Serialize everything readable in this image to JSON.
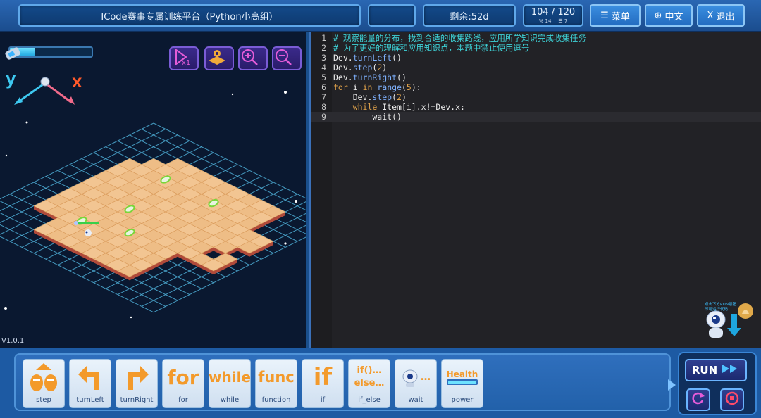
{
  "header": {
    "title": "ICode赛事专属训练平台（Python小高组）",
    "time_remaining": "剩余:52d",
    "score_main": "104 / 120",
    "score_sub_a": "14",
    "score_sub_b": "7",
    "menu_label": "菜单",
    "lang_label": "中文",
    "exit_label": "退出"
  },
  "game": {
    "version": "V1.0.1",
    "axis_y": "y",
    "axis_x": "x",
    "energy_fraction": 0.3,
    "tools": [
      "speed-x1",
      "map-view",
      "zoom-in",
      "zoom-out"
    ]
  },
  "editor": {
    "lines": [
      {
        "num": "1",
        "text": "# 观察能量的分布，找到合适的收集路线，应用所学知识完成收集任务"
      },
      {
        "num": "2",
        "text": "# 为了更好的理解和应用知识点，本题中禁止使用逗号"
      },
      {
        "num": "3",
        "text": "Dev.turnLeft()"
      },
      {
        "num": "4",
        "text": "Dev.step(2)"
      },
      {
        "num": "5",
        "text": "Dev.turnRight()"
      },
      {
        "num": "6",
        "text": "for i in range(5):"
      },
      {
        "num": "7",
        "text": "    Dev.step(2)"
      },
      {
        "num": "8",
        "text": "    while Item[i].x!=Dev.x:"
      },
      {
        "num": "9",
        "text": "        wait()"
      }
    ],
    "hint_line1": "点击下方RUN按钮",
    "hint_line2": "即可运行代码"
  },
  "palette": {
    "blocks": [
      {
        "label": "step",
        "word": ""
      },
      {
        "label": "turnLeft",
        "word": ""
      },
      {
        "label": "turnRight",
        "word": ""
      },
      {
        "label": "for",
        "word": "for"
      },
      {
        "label": "while",
        "word": "while"
      },
      {
        "label": "function",
        "word": "func"
      },
      {
        "label": "if",
        "word": "if"
      },
      {
        "label": "if_else",
        "word": "if()…else…"
      },
      {
        "label": "wait",
        "word": "…"
      },
      {
        "label": "power",
        "word": "Health"
      }
    ]
  },
  "run": {
    "run_label": "RUN"
  },
  "colors": {
    "accent": "#2f6fbd",
    "tile": "#f2c592",
    "grid": "#4fb0d8",
    "comment": "#3ed3d8"
  }
}
